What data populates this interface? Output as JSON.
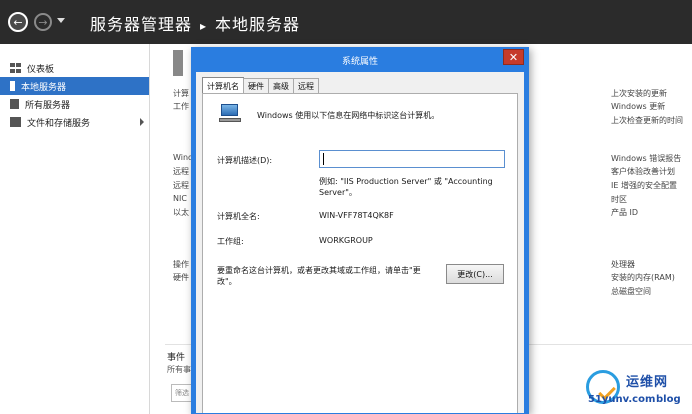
{
  "header": {
    "app_title": "服务器管理器",
    "separator": "▸",
    "page_title": "本地服务器"
  },
  "sidebar": {
    "items": [
      {
        "label": "仪表板"
      },
      {
        "label": "本地服务器"
      },
      {
        "label": "所有服务器"
      },
      {
        "label": "文件和存储服务"
      }
    ]
  },
  "background": {
    "left_labels": [
      "计算",
      "工作",
      "Windo",
      "远程",
      "远程",
      "NIC",
      "以太",
      "操作",
      "硬件"
    ],
    "right_labels": [
      "上次安装的更新",
      "Windows 更新",
      "上次检查更新的时间",
      "Windows 错误报告",
      "客户体验改善计划",
      "IE 增强的安全配置",
      "时区",
      "产品 ID",
      "处理器",
      "安装的内存(RAM)",
      "总磁盘空间"
    ],
    "events_title": "事件",
    "events_sub": "所有事",
    "events_filter": "筛选"
  },
  "dialog": {
    "title": "系统属性",
    "close_glyph": "✕",
    "tabs": [
      {
        "label": "计算机名",
        "active": true
      },
      {
        "label": "硬件",
        "active": false
      },
      {
        "label": "高级",
        "active": false
      },
      {
        "label": "远程",
        "active": false
      }
    ],
    "intro": "Windows 使用以下信息在网络中标识这台计算机。",
    "description_label": "计算机描述(D):",
    "description_value": "",
    "example_text": "例如: \"IIS Production Server\" 或 \"Accounting Server\"。",
    "full_name_label": "计算机全名:",
    "full_name_value": "WIN-VFF78T4QK8F",
    "workgroup_label": "工作组:",
    "workgroup_value": "WORKGROUP",
    "rename_text": "要重命名这台计算机，或者更改其域或工作组，请单击\"更改\"。",
    "change_button": "更改(C)..."
  },
  "watermark": {
    "title": "运维网",
    "url": "51yunv.com",
    "blog": "blog"
  },
  "colors": {
    "titlebar": "#2b2b2b",
    "accent": "#2a7de0",
    "nav_active": "#2e72c6",
    "close": "#c63b2b"
  }
}
